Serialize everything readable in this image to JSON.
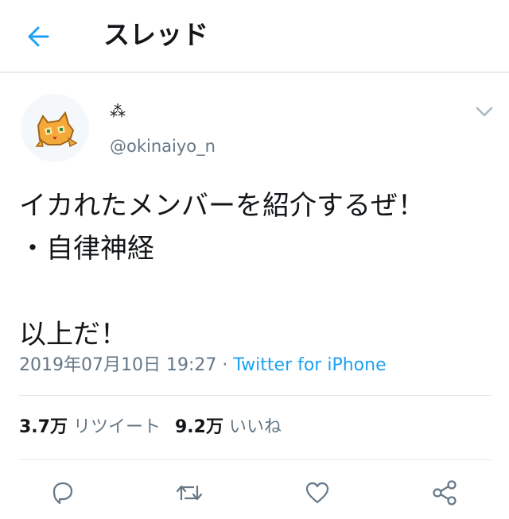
{
  "header": {
    "title": "スレッド"
  },
  "tweet": {
    "display_name": "⁂",
    "handle": "@okinaiyo_n",
    "lines": [
      "イカれたメンバーを紹介するぜ！",
      "・自律神経",
      "",
      "以上だ！"
    ],
    "timestamp": "2019年07月10日 19:27",
    "separator": "·",
    "source": "Twitter for iPhone",
    "retweets_count": "3.7万",
    "retweets_label": "リツイート",
    "likes_count": "9.2万",
    "likes_label": "いいね"
  },
  "colors": {
    "accent": "#1da1f2",
    "text": "#14171a",
    "secondary": "#657786",
    "divider": "#e1e8ed"
  },
  "icons": {
    "back": "arrow-left-icon",
    "more": "chevron-down-icon",
    "reply": "reply-icon",
    "retweet": "retweet-icon",
    "like": "heart-icon",
    "share": "share-icon"
  }
}
